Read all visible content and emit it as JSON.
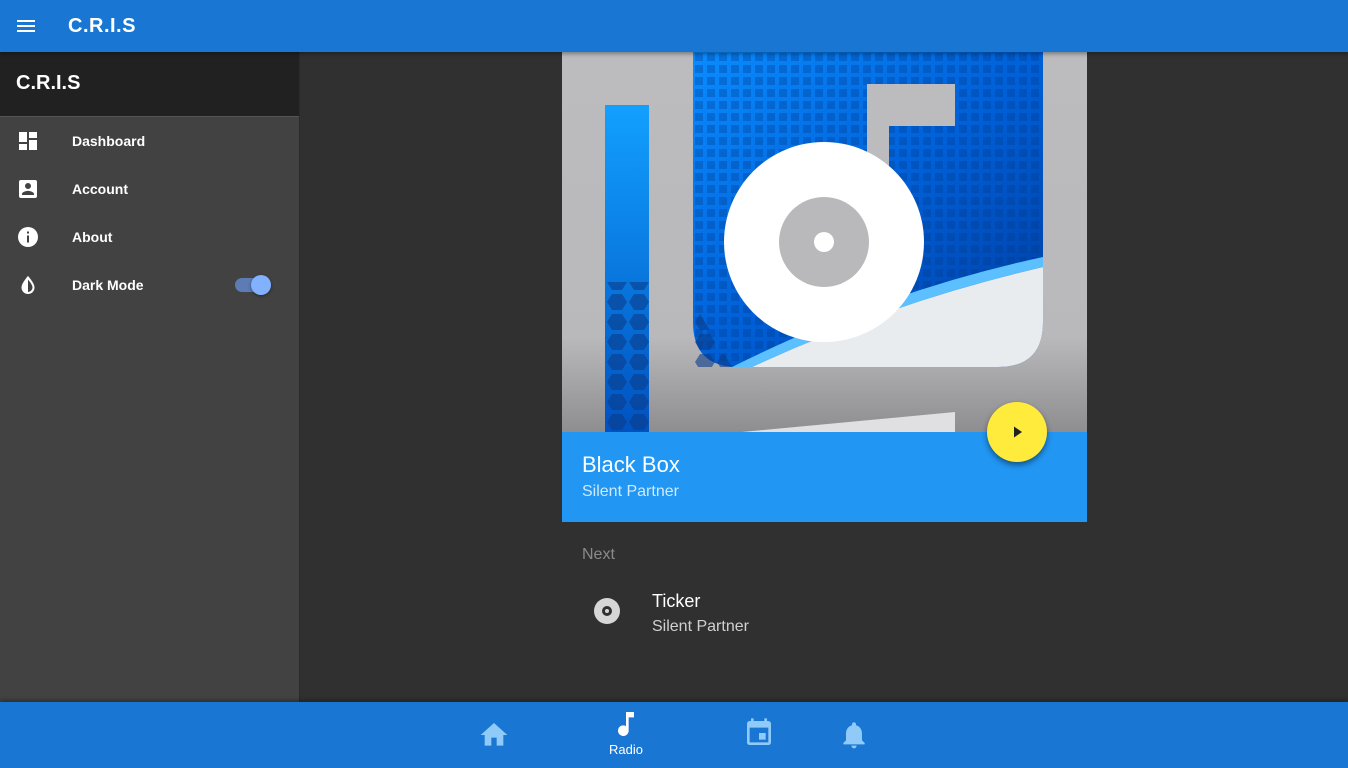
{
  "app": {
    "title": "C.R.I.S"
  },
  "drawer": {
    "title": "C.R.I.S",
    "items": [
      {
        "label": "Dashboard",
        "icon": "dashboard-icon"
      },
      {
        "label": "Account",
        "icon": "account-box-icon"
      },
      {
        "label": "About",
        "icon": "info-icon"
      },
      {
        "label": "Dark Mode",
        "icon": "invert-colors-icon"
      }
    ],
    "dark_mode_on": true
  },
  "now_playing": {
    "title": "Black Box",
    "artist": "Silent Partner"
  },
  "queue": {
    "label": "Next",
    "items": [
      {
        "title": "Ticker",
        "artist": "Silent Partner",
        "icon": "disc-icon"
      }
    ]
  },
  "bottom_nav": {
    "items": [
      {
        "icon": "home-icon",
        "label": ""
      },
      {
        "icon": "music-note-icon",
        "label": "Radio",
        "active": true
      },
      {
        "icon": "calendar-icon",
        "label": ""
      },
      {
        "icon": "bell-icon",
        "label": ""
      }
    ]
  },
  "colors": {
    "primary": "#1976d2",
    "accent_card": "#2196f3",
    "fab": "#ffeb3b",
    "background": "#303030",
    "drawer": "#424242"
  }
}
